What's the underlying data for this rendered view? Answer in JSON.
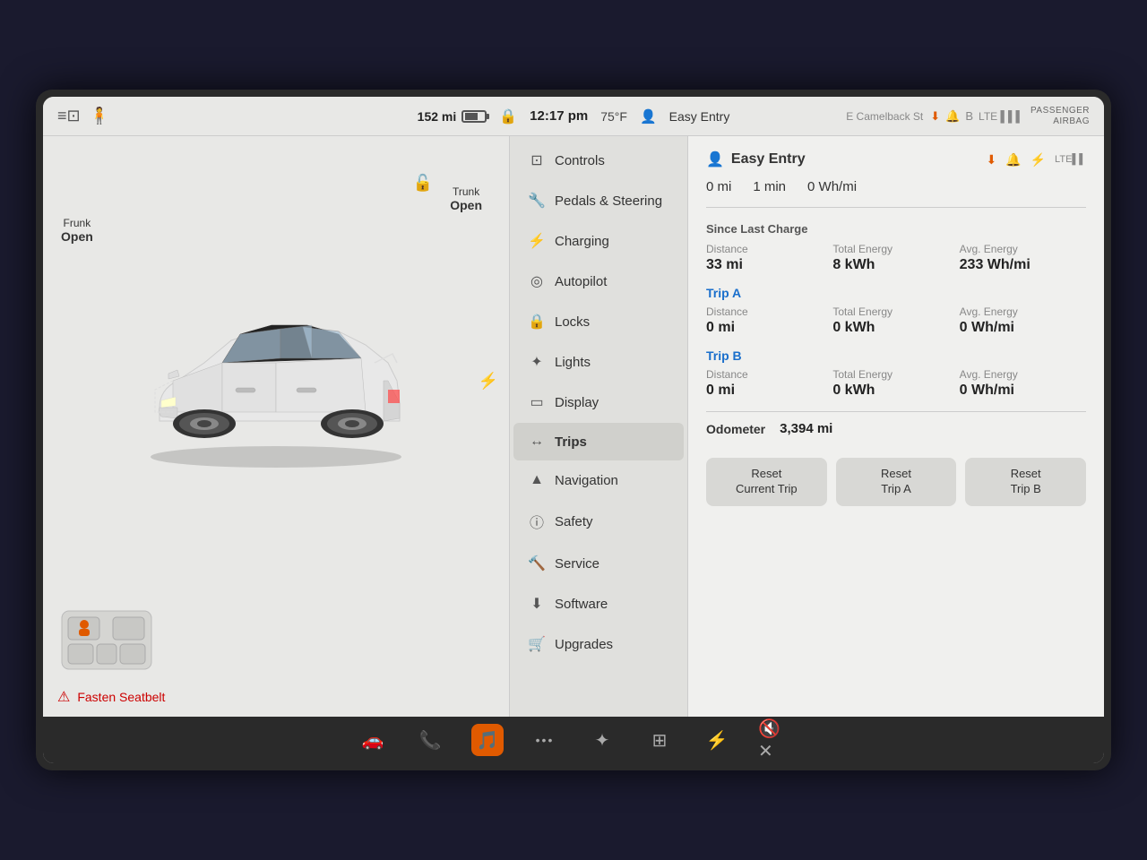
{
  "topBar": {
    "gear": "⚙",
    "range": "152 mi",
    "lockIcon": "🔒",
    "time": "12:17 pm",
    "temp": "75°F",
    "profileIcon": "👤",
    "profileLabel": "Easy Entry",
    "address": "E Camelback St",
    "passengerAirbag": "PASSENGER\nAIRBAG",
    "downloadIcon": "⬇",
    "bellIcon": "🔔",
    "bluetoothIcon": "⚡",
    "signalIcon": "📶"
  },
  "leftPanel": {
    "frunkLabel": "Frunk",
    "frunkStatus": "Open",
    "trunkLabel": "Trunk",
    "trunkStatus": "Open",
    "seatbeltAlert": "Fasten Seatbelt"
  },
  "menu": {
    "items": [
      {
        "id": "controls",
        "icon": "⊡",
        "label": "Controls"
      },
      {
        "id": "pedals",
        "icon": "🔧",
        "label": "Pedals & Steering"
      },
      {
        "id": "charging",
        "icon": "⚡",
        "label": "Charging"
      },
      {
        "id": "autopilot",
        "icon": "🎮",
        "label": "Autopilot"
      },
      {
        "id": "locks",
        "icon": "🔒",
        "label": "Locks"
      },
      {
        "id": "lights",
        "icon": "💡",
        "label": "Lights"
      },
      {
        "id": "display",
        "icon": "🖥",
        "label": "Display"
      },
      {
        "id": "trips",
        "icon": "↔",
        "label": "Trips",
        "active": true
      },
      {
        "id": "navigation",
        "icon": "▲",
        "label": "Navigation"
      },
      {
        "id": "safety",
        "icon": "ℹ",
        "label": "Safety"
      },
      {
        "id": "service",
        "icon": "🔨",
        "label": "Service"
      },
      {
        "id": "software",
        "icon": "⬇",
        "label": "Software"
      },
      {
        "id": "upgrades",
        "icon": "🛒",
        "label": "Upgrades"
      }
    ]
  },
  "rightPanel": {
    "title": "Easy Entry",
    "quickStats": {
      "distance": "0 mi",
      "time": "1 min",
      "energy": "0 Wh/mi"
    },
    "sinceLastCharge": {
      "sectionTitle": "Since Last Charge",
      "distanceLabel": "Distance",
      "distanceValue": "33 mi",
      "totalEnergyLabel": "Total Energy",
      "totalEnergyValue": "8 kWh",
      "avgEnergyLabel": "Avg. Energy",
      "avgEnergyValue": "233 Wh/mi"
    },
    "tripA": {
      "label": "Trip A",
      "distanceLabel": "Distance",
      "distanceValue": "0 mi",
      "totalEnergyLabel": "Total Energy",
      "totalEnergyValue": "0 kWh",
      "avgEnergyLabel": "Avg. Energy",
      "avgEnergyValue": "0 Wh/mi"
    },
    "tripB": {
      "label": "Trip B",
      "distanceLabel": "Distance",
      "distanceValue": "0 mi",
      "totalEnergyLabel": "Total Energy",
      "totalEnergyValue": "0 kWh",
      "avgEnergyLabel": "Avg. Energy",
      "avgEnergyValue": "0 Wh/mi"
    },
    "odometerLabel": "Odometer",
    "odometerValue": "3,394 mi",
    "resetCurrentTrip": "Reset\nCurrent Trip",
    "resetTripA": "Reset\nTrip A",
    "resetTripB": "Reset\nTrip B"
  },
  "bottomBar": {
    "carIcon": "🚗",
    "phoneIcon": "📞",
    "musicIcon": "🎵",
    "dotsIcon": "•••",
    "gameIcon": "🎮",
    "gridIcon": "⊞",
    "bluetoothIcon": "⚡",
    "volumeIcon": "🔇"
  }
}
